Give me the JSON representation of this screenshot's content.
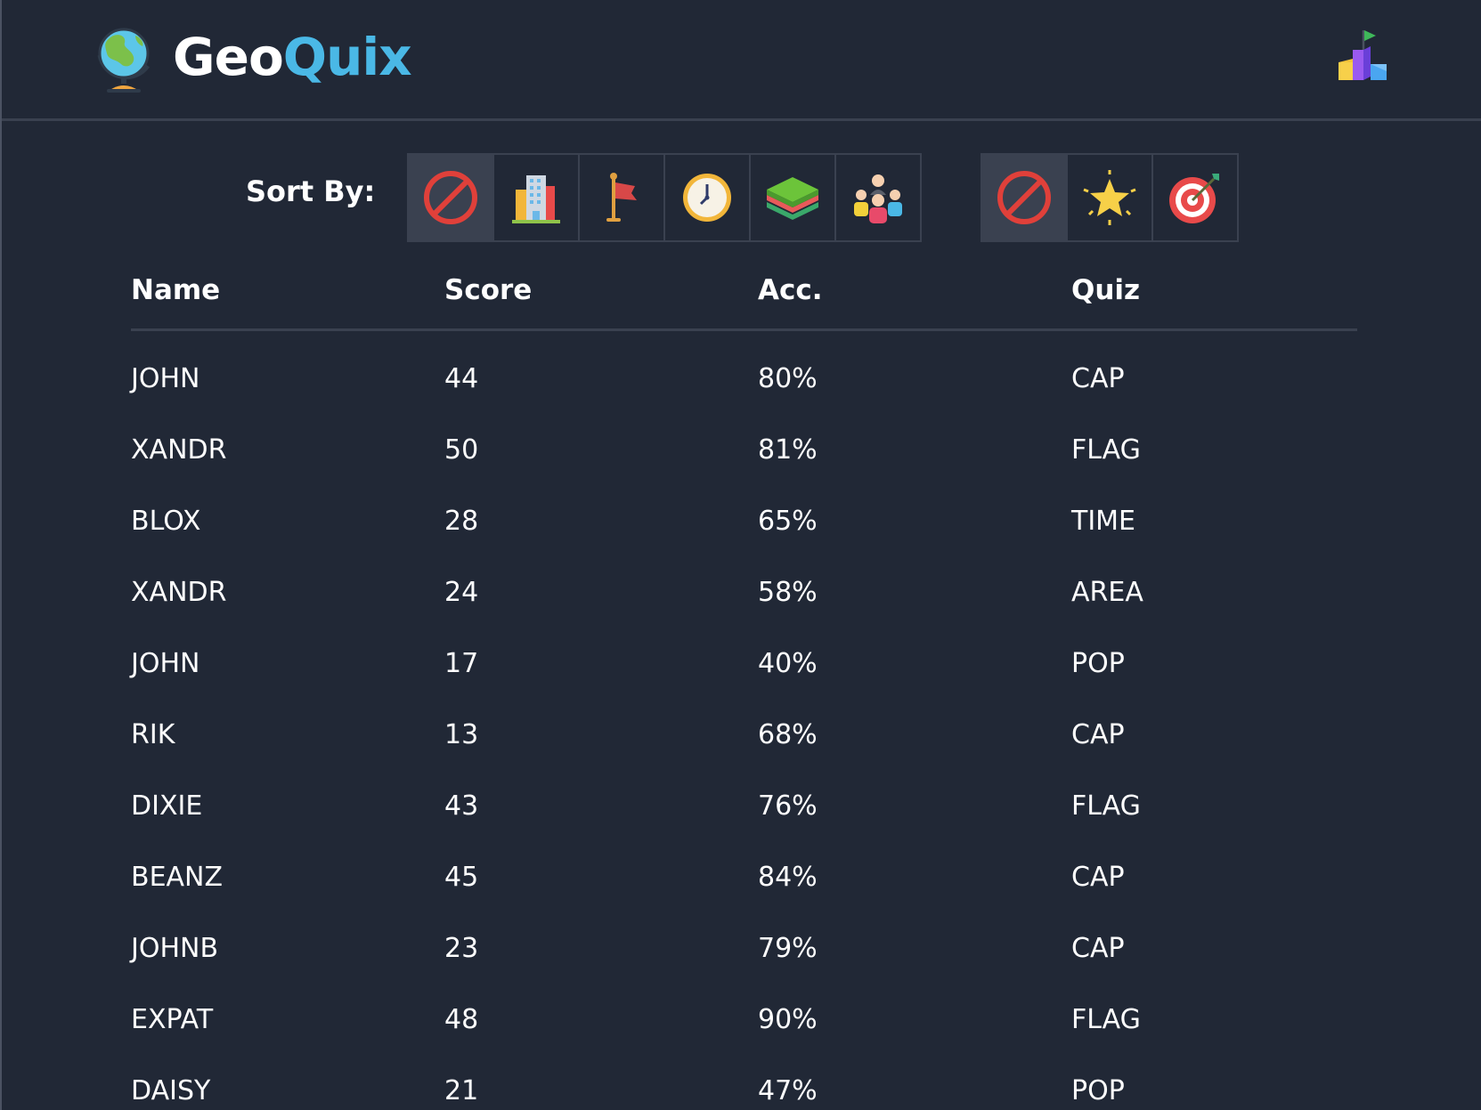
{
  "header": {
    "brand_geo": "Geo",
    "brand_quix": "Quix",
    "logo_icon": "globe-icon",
    "leaderboard_icon": "podium-icon"
  },
  "sort": {
    "label": "Sort By:",
    "quiz_filters": [
      {
        "icon": "no-filter-icon",
        "active": true
      },
      {
        "icon": "buildings-icon",
        "active": false
      },
      {
        "icon": "flag-icon",
        "active": false
      },
      {
        "icon": "clock-icon",
        "active": false
      },
      {
        "icon": "land-layers-icon",
        "active": false
      },
      {
        "icon": "people-icon",
        "active": false
      }
    ],
    "metric_filters": [
      {
        "icon": "no-filter-icon",
        "active": true
      },
      {
        "icon": "star-icon",
        "active": false
      },
      {
        "icon": "target-icon",
        "active": false
      }
    ]
  },
  "table": {
    "headers": {
      "name": "Name",
      "score": "Score",
      "acc": "Acc.",
      "quiz": "Quiz"
    },
    "rows": [
      {
        "name": "JOHN",
        "score": "44",
        "acc": "80%",
        "quiz": "CAP"
      },
      {
        "name": "XANDR",
        "score": "50",
        "acc": "81%",
        "quiz": "FLAG"
      },
      {
        "name": "BLOX",
        "score": "28",
        "acc": "65%",
        "quiz": "TIME"
      },
      {
        "name": "XANDR",
        "score": "24",
        "acc": "58%",
        "quiz": "AREA"
      },
      {
        "name": "JOHN",
        "score": "17",
        "acc": "40%",
        "quiz": "POP"
      },
      {
        "name": "RIK",
        "score": "13",
        "acc": "68%",
        "quiz": "CAP"
      },
      {
        "name": "DIXIE",
        "score": "43",
        "acc": "76%",
        "quiz": "FLAG"
      },
      {
        "name": "BEANZ",
        "score": "45",
        "acc": "84%",
        "quiz": "CAP"
      },
      {
        "name": "JOHNB",
        "score": "23",
        "acc": "79%",
        "quiz": "CAP"
      },
      {
        "name": "EXPAT",
        "score": "48",
        "acc": "90%",
        "quiz": "FLAG"
      },
      {
        "name": "DAISY",
        "score": "21",
        "acc": "47%",
        "quiz": "POP"
      }
    ]
  },
  "colors": {
    "background": "#212836",
    "divider": "#3a4150",
    "accent": "#4ab8e6",
    "text": "#ffffff"
  }
}
